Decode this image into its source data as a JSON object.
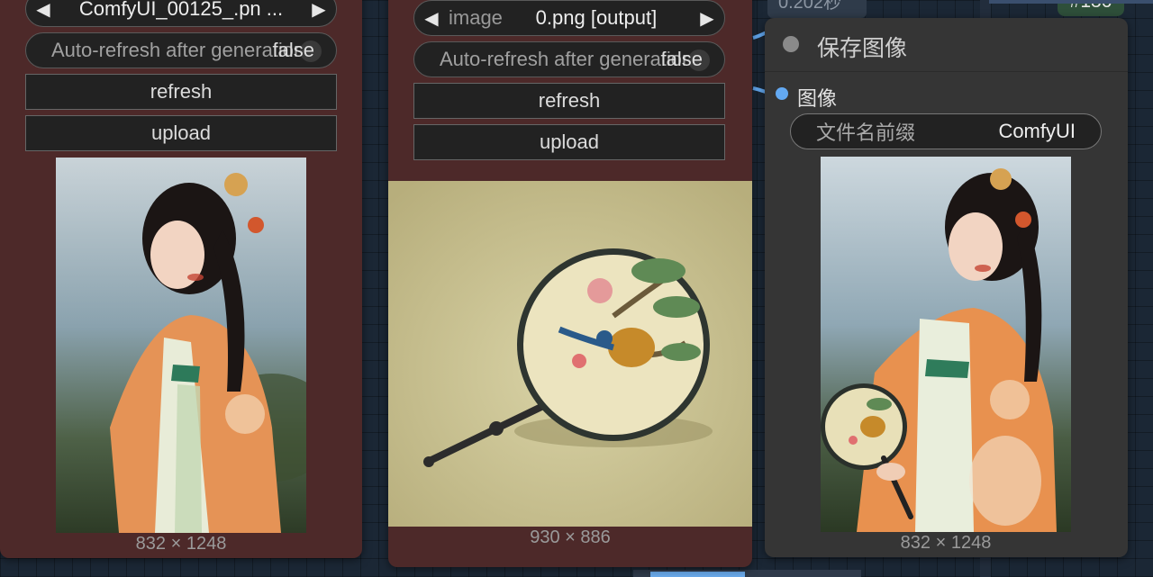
{
  "colors": {
    "canvas_bg": "#1b2735",
    "node_red": "#4d2929",
    "node_dark": "#353535",
    "link_blue": "#63a9f2",
    "badge_green": "#2e4f3a"
  },
  "top_tags": {
    "time": "0.202秒",
    "node_id": "#136"
  },
  "node_left": {
    "image_combo": {
      "value": "ComfyUI_00125_.pn  ...",
      "prev_icon": "arrow-left-icon",
      "next_icon": "arrow-right-icon"
    },
    "auto_refresh": {
      "label": "Auto-refresh after generation",
      "value": "false"
    },
    "refresh_label": "refresh",
    "upload_label": "upload",
    "preview_dims": "832 × 1248"
  },
  "node_middle": {
    "image_combo": {
      "label": "image",
      "value": "0.png [output]",
      "prev_icon": "arrow-left-icon",
      "next_icon": "arrow-right-icon"
    },
    "auto_refresh": {
      "label": "Auto-refresh after generation",
      "value": "false"
    },
    "refresh_label": "refresh",
    "upload_label": "upload",
    "preview_dims": "930 × 886"
  },
  "node_save": {
    "title": "保存图像",
    "input_slot": "图像",
    "filename_prefix": {
      "label": "文件名前缀",
      "value": "ComfyUI"
    },
    "preview_dims": "832 × 1248"
  }
}
